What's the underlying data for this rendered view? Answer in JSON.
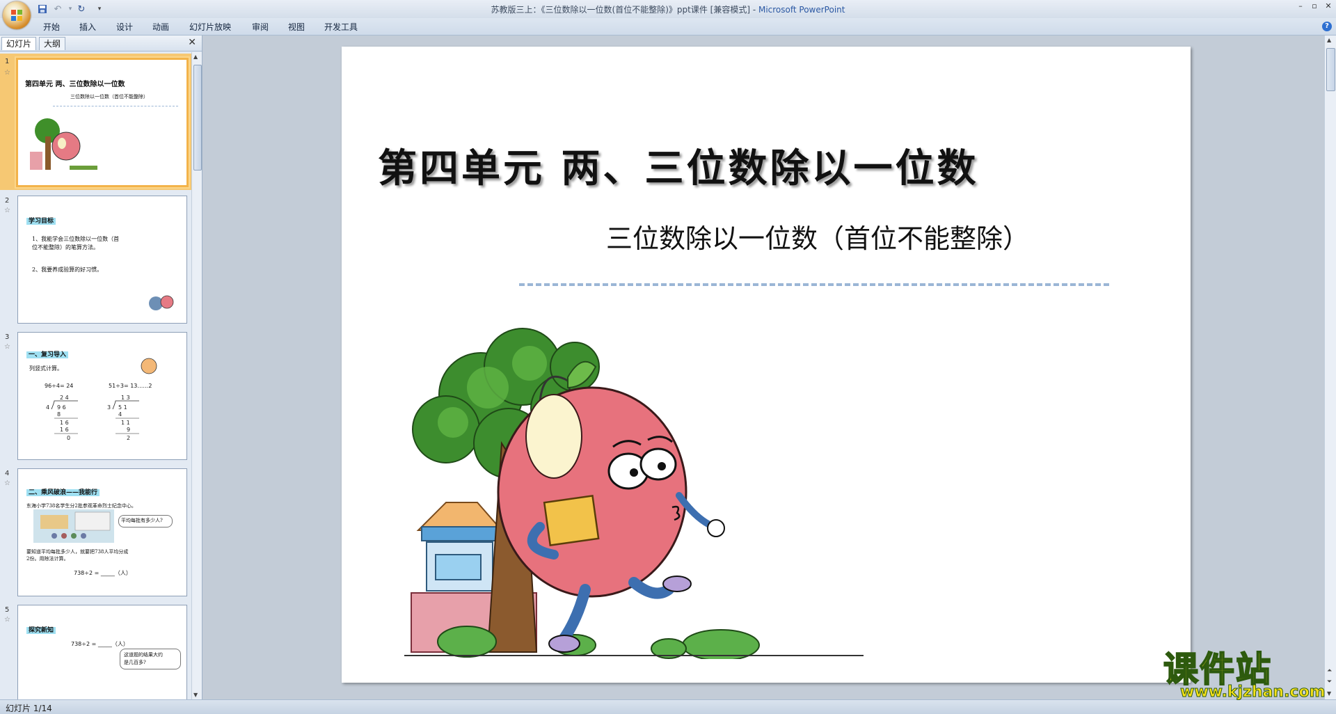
{
  "window": {
    "title_prefix": "苏教版三上：《三位数除以一位数(首位不能整除)》ppt课件 [兼容模式] - ",
    "app_name": "Microsoft PowerPoint"
  },
  "ribbon": {
    "tabs": [
      "开始",
      "插入",
      "设计",
      "动画",
      "幻灯片放映",
      "审阅",
      "视图",
      "开发工具"
    ]
  },
  "panel": {
    "tabs": [
      "幻灯片",
      "大纲"
    ],
    "close_symbol": "✕"
  },
  "thumbnails": [
    {
      "num": "1",
      "title": "第四单元  两、三位数除以一位数",
      "subtitle": "三位数除以一位数（首位不能整除）"
    },
    {
      "num": "2",
      "heading": "学习目标",
      "lines": [
        "1、我能学会三位数除以一位数（首",
        "位不能整除）的笔算方法。",
        "2、我要养成验算的好习惯。"
      ]
    },
    {
      "num": "3",
      "heading": "一、复习导入",
      "lines": [
        "列竖式计算。",
        "96÷4= 24",
        "51÷3= 13……2"
      ]
    },
    {
      "num": "4",
      "heading": "二、乘风破浪——我能行",
      "lines": [
        "东海小学738名学生分2批参观革命烈士纪念中心。",
        "平均每批有多少人?",
        "要知道平均每批多少人，就要把738人平均分成",
        "2份。用除法计算。",
        "738÷2 = _____（人）"
      ]
    },
    {
      "num": "5",
      "heading": "探究新知",
      "lines": [
        "738÷2 = _____（人）",
        "这道题的结果大约",
        "是几百多?"
      ]
    }
  ],
  "slide": {
    "title": "第四单元  两、三位数除以一位数",
    "subtitle": "三位数除以一位数（首位不能整除）"
  },
  "status": {
    "text": "幻灯片 1/14"
  },
  "watermark": {
    "title": "课件站",
    "url": "www.kjzhan.com"
  }
}
